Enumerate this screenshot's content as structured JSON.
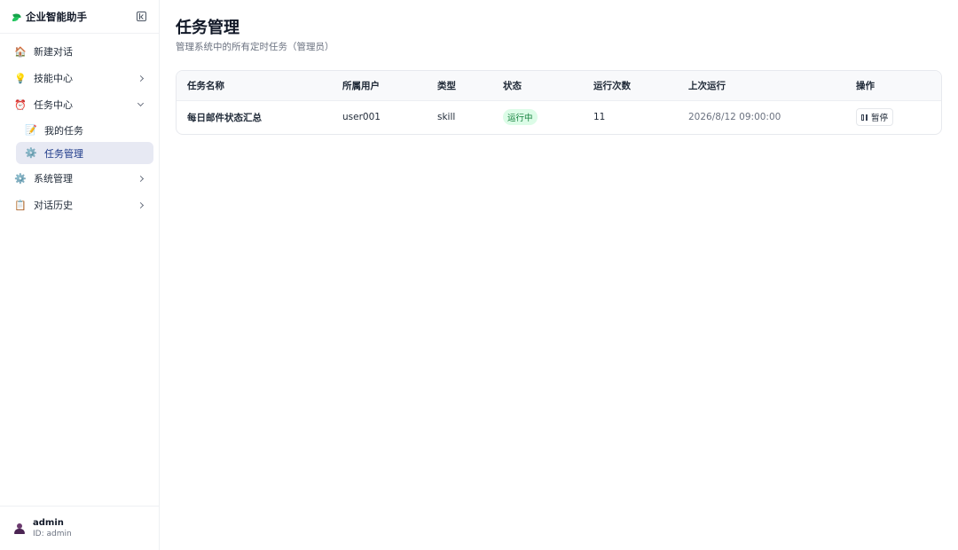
{
  "app": {
    "title": "企业智能助手"
  },
  "sidebar": {
    "items": [
      {
        "label": "新建对话",
        "icon": "house-icon"
      },
      {
        "label": "技能中心",
        "icon": "lightbulb-icon"
      },
      {
        "label": "任务中心",
        "icon": "alarm-clock-icon"
      },
      {
        "label": "系统管理",
        "icon": "gear-icon"
      },
      {
        "label": "对话历史",
        "icon": "clipboard-icon"
      }
    ],
    "subitems": [
      {
        "label": "我的任务",
        "icon": "memo-icon"
      },
      {
        "label": "任务管理",
        "icon": "gear-icon"
      }
    ]
  },
  "user": {
    "name": "admin",
    "id_text": "ID: admin"
  },
  "page": {
    "title": "任务管理",
    "subtitle": "管理系统中的所有定时任务（管理员）"
  },
  "table": {
    "columns": [
      "任务名称",
      "所属用户",
      "类型",
      "状态",
      "运行次数",
      "上次运行",
      "操作"
    ],
    "rows": [
      {
        "name": "每日邮件状态汇总",
        "user": "user001",
        "type": "skill",
        "status": "运行中",
        "runs": "11",
        "last_run": "2026/8/12 09:00:00",
        "action": "暂停"
      }
    ]
  },
  "colors": {
    "accent": "#1e3a8a",
    "active_bg": "#e7e9f3",
    "status_running_bg": "#dcfce7",
    "status_running_text": "#15803d"
  }
}
